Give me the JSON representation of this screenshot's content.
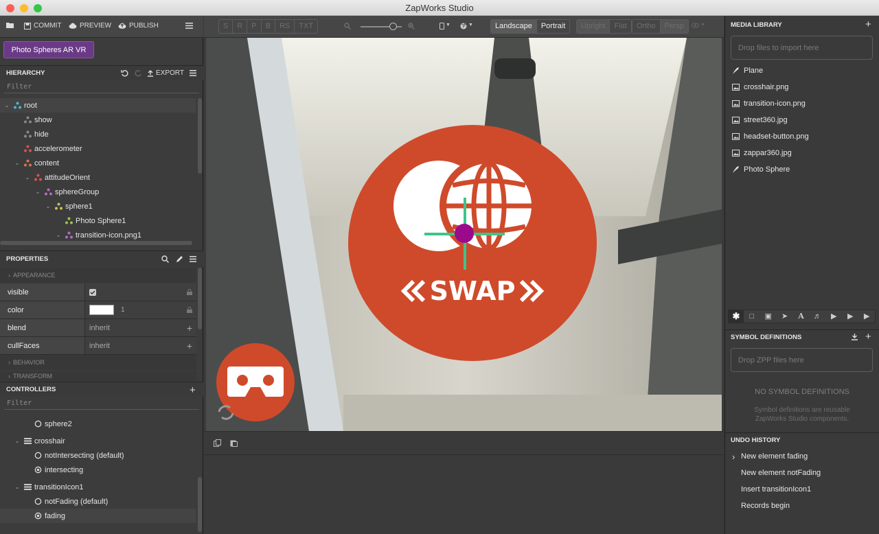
{
  "window": {
    "title": "ZapWorks Studio"
  },
  "toolbar": {
    "commit": "COMMIT",
    "preview": "PREVIEW",
    "publish": "PUBLISH"
  },
  "project": {
    "name": "Photo Spheres AR VR"
  },
  "hierarchy": {
    "title": "HIERARCHY",
    "export": "EXPORT",
    "filter_placeholder": "Filter",
    "items": [
      {
        "label": "root",
        "icon": "group-icon",
        "color": "#4bb8c4"
      },
      {
        "label": "show",
        "icon": "shuffle-icon",
        "color": "#888888"
      },
      {
        "label": "hide",
        "icon": "shuffle-icon",
        "color": "#888888"
      },
      {
        "label": "accelerometer",
        "icon": "sync-icon",
        "color": "#d9534f"
      },
      {
        "label": "content",
        "icon": "group-icon",
        "color": "#d9734f"
      },
      {
        "label": "attitudeOrient",
        "icon": "orient-icon",
        "color": "#d9534f"
      },
      {
        "label": "sphereGroup",
        "icon": "group-icon",
        "color": "#b569c7"
      },
      {
        "label": "sphere1",
        "icon": "group-icon",
        "color": "#c9c24f"
      },
      {
        "label": "Photo Sphere1",
        "icon": "rocket-icon",
        "color": "#9ec24f"
      },
      {
        "label": "transition-icon.png1",
        "icon": "rocket-icon",
        "color": "#b569c7"
      }
    ]
  },
  "properties": {
    "title": "PROPERTIES",
    "appearance": "APPEARANCE",
    "rows": [
      {
        "key": "visible",
        "value": "checked"
      },
      {
        "key": "color",
        "value": "1"
      },
      {
        "key": "blend",
        "value": "inherit"
      },
      {
        "key": "cullFaces",
        "value": "inherit"
      }
    ],
    "behavior": "BEHAVIOR",
    "transform": "TRANSFORM"
  },
  "controllers": {
    "title": "CONTROLLERS",
    "filter_placeholder": "Filter",
    "items": [
      {
        "label": "sphere2",
        "type": "state"
      },
      {
        "label": "crosshair",
        "type": "controller"
      },
      {
        "label": "notIntersecting (default)",
        "type": "state"
      },
      {
        "label": "intersecting",
        "type": "state-active"
      },
      {
        "label": "transitionIcon1",
        "type": "controller"
      },
      {
        "label": "notFading (default)",
        "type": "state"
      },
      {
        "label": "fading",
        "type": "state-active"
      }
    ]
  },
  "view": {
    "text_buttons": [
      "S",
      "R",
      "P",
      "B",
      "RS",
      "TXT"
    ],
    "orientation": [
      "Landscape",
      "Portrait"
    ],
    "mode": [
      "Upright",
      "Flat"
    ],
    "projection": [
      "Ortho",
      "Persp"
    ],
    "zoom_level": 0.78,
    "swap_text": "SWAP",
    "accent": "#cf4a2b"
  },
  "media_library": {
    "title": "MEDIA LIBRARY",
    "drop_hint": "Drop files to import here",
    "items": [
      {
        "label": "Plane",
        "icon": "rocket-icon"
      },
      {
        "label": "crosshair.png",
        "icon": "image-icon"
      },
      {
        "label": "transition-icon.png",
        "icon": "image-icon"
      },
      {
        "label": "street360.jpg",
        "icon": "image-icon"
      },
      {
        "label": "headset-button.png",
        "icon": "image-icon"
      },
      {
        "label": "zappar360.jpg",
        "icon": "image-icon"
      },
      {
        "label": "Photo Sphere",
        "icon": "rocket-icon"
      }
    ]
  },
  "symbols": {
    "title": "SYMBOL DEFINITIONS",
    "drop_hint": "Drop ZPP files here",
    "empty_title": "NO SYMBOL DEFINITIONS",
    "empty_desc_1": "Symbol definitions are reusable",
    "empty_desc_2": "ZapWorks Studio components."
  },
  "undo": {
    "title": "UNDO HISTORY",
    "items": [
      "New element fading",
      "New element notFading",
      "Insert transitionIcon1",
      "Records begin"
    ]
  }
}
